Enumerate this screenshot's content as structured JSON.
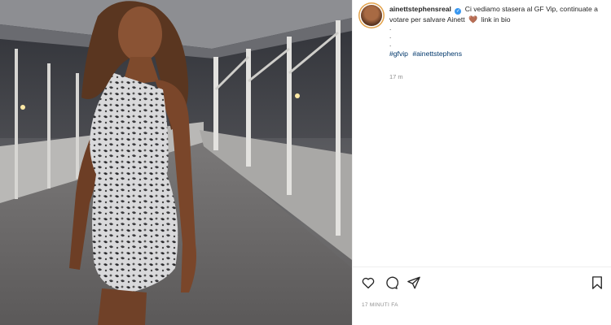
{
  "post": {
    "username": "ainettstephensreal",
    "verified_badge": "✓",
    "caption_text": "Ci vediamo stasera al GF Vip, continuate a votare per salvare Ainett",
    "caption_heart": "🤎",
    "caption_suffix": "link in bio",
    "caption_dots": [
      ".",
      ".",
      "."
    ],
    "hashtags": [
      "#gfvip",
      "#ainettstephens"
    ],
    "comment_time": "17 m",
    "posted_ago": "17 MINUTI FA"
  },
  "icons": {
    "like": "heart-outline-icon",
    "comment": "comment-bubble-icon",
    "share": "paper-plane-icon",
    "save": "bookmark-icon"
  },
  "colors": {
    "text": "#262626",
    "muted": "#8e8e8e",
    "hashtag": "#00376b",
    "verified": "#3897f0"
  }
}
